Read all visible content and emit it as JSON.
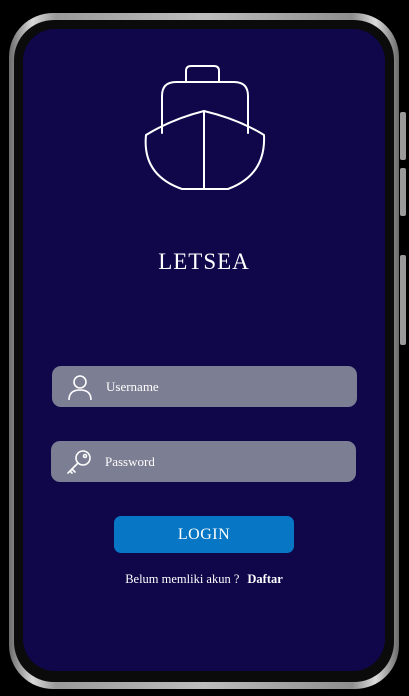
{
  "app": {
    "title": "LETSEA"
  },
  "username": {
    "placeholder": "Username",
    "icon": "user-icon"
  },
  "password": {
    "placeholder": "Password",
    "icon": "key-icon"
  },
  "login_button": {
    "label": "LOGIN"
  },
  "signup": {
    "prompt": "Belum memliki akun ?",
    "link": "Daftar"
  },
  "colors": {
    "screen_bg": "#10064a",
    "field_bg": "#7c7e93",
    "button_bg": "#0776c4",
    "text": "#ffffff"
  }
}
